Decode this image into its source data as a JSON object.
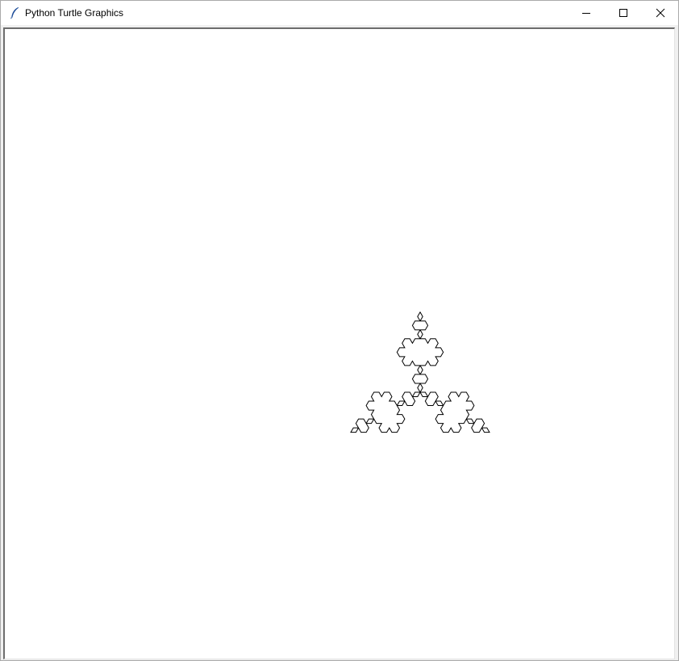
{
  "window": {
    "title": "Python Turtle Graphics",
    "app_icon": "feather-icon",
    "controls": {
      "minimize_icon": "minimize-icon",
      "maximize_icon": "maximize-icon",
      "close_icon": "close-icon"
    }
  },
  "canvas": {
    "background": "#ffffff",
    "drawing": {
      "shape": "koch-snowflake",
      "recursion_depth": 3,
      "stroke_color": "#000000"
    }
  }
}
